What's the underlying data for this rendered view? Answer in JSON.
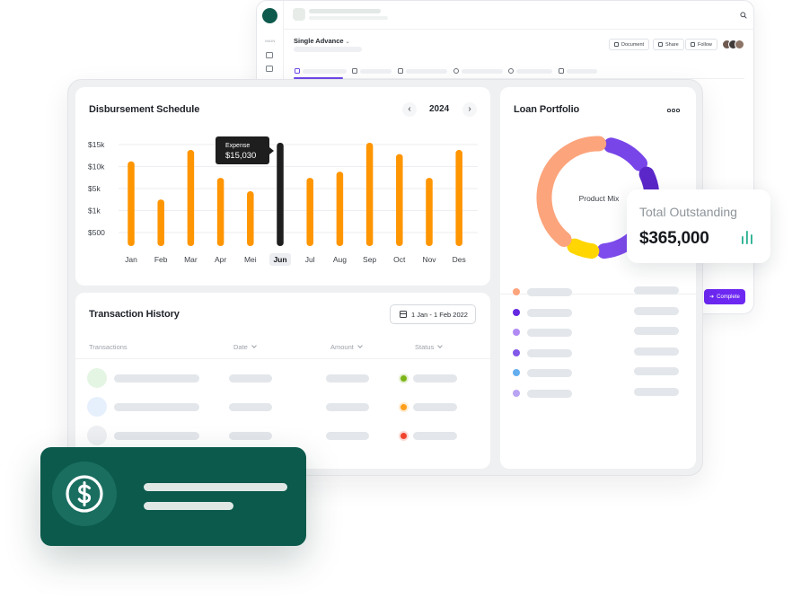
{
  "back_window": {
    "sidebar_label": "MAIN",
    "title": "Single Advance",
    "buttons": {
      "document": "Document",
      "share": "Share",
      "follow": "Follow"
    },
    "complete_button": "Complete"
  },
  "schedule": {
    "title": "Disbursement Schedule",
    "year": "2024",
    "prev_icon": "chevron-left-icon",
    "next_icon": "chevron-right-icon",
    "tooltip": {
      "label": "Expense",
      "value": "$15,030"
    },
    "highlight_month": "Jun",
    "colors": {
      "bar": "#FF9500",
      "highlight": "#1E1E1E"
    }
  },
  "chart_data": {
    "type": "bar",
    "categories": [
      "Jan",
      "Feb",
      "Mar",
      "Apr",
      "Mei",
      "Jun",
      "Jul",
      "Aug",
      "Sep",
      "Oct",
      "Nov",
      "Des"
    ],
    "tick_labels": [
      "$15k",
      "$10k",
      "$5k",
      "$1k",
      "$500"
    ],
    "values": [
      0.82,
      0.45,
      0.93,
      0.66,
      0.53,
      1.0,
      0.66,
      0.72,
      1.0,
      0.89,
      0.66,
      0.93
    ],
    "value_scale": "fraction of chart height",
    "grid": true,
    "legend": "none"
  },
  "transactions": {
    "title": "Transaction History",
    "date_range": "1 Jan - 1 Feb 2022",
    "columns": [
      "Transactions",
      "Date",
      "Amount",
      "Status"
    ],
    "rows": [
      {
        "avatar_color": "#E4F5E4",
        "status_color": "#7CB518"
      },
      {
        "avatar_color": "#E6F0FD",
        "status_color": "#FF9F1C"
      },
      {
        "avatar_color": "#EDEFF2",
        "status_color": "#F0442E"
      }
    ]
  },
  "portfolio": {
    "title": "Loan Portfolio",
    "donut_center": "Product Mix",
    "segments": [
      {
        "color": "#7845E8",
        "share": 0.14
      },
      {
        "color": "#5B27C9",
        "share": 0.2
      },
      {
        "color": "#7E4BEC",
        "share": 0.14
      },
      {
        "color": "#FFD600",
        "share": 0.09
      },
      {
        "color": "#FCA47C",
        "share": 0.43
      }
    ],
    "legend_colors": [
      "#FCA47C",
      "#6428E0",
      "#B18BF3",
      "#8258E8",
      "#63AEEF",
      "#B9A3F3"
    ]
  },
  "total": {
    "label": "Total Outstanding",
    "value": "$365,000",
    "icon": "bar-chart-icon",
    "accent": "#27B08F"
  },
  "payment_card": {
    "icon": "dollar-icon",
    "bg": "#0B5A4C"
  }
}
